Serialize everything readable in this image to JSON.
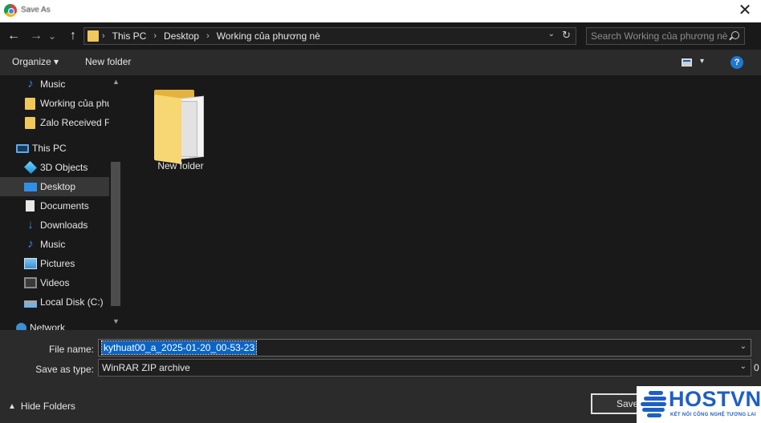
{
  "window": {
    "title": "Save As",
    "close_glyph": "✕"
  },
  "nav": {
    "back_glyph": "←",
    "forward_glyph": "→",
    "recent_glyph": "⌄",
    "up_glyph": "↑",
    "breadcrumbs": [
      "This PC",
      "Desktop",
      "Working của phương nè"
    ],
    "breadcrumb_sep": "›",
    "search_placeholder": "Search Working của phương nè"
  },
  "toolbar": {
    "organize_label": "Organize ▾",
    "new_folder_label": "New folder",
    "help_glyph": "?",
    "view_dd_glyph": "▾"
  },
  "sidebar": {
    "items": [
      {
        "label": "Music",
        "icon": "music-icon"
      },
      {
        "label": "Working của phư",
        "icon": "folder-icon"
      },
      {
        "label": "Zalo Received Fi",
        "icon": "folder-icon"
      },
      {
        "label": "This PC",
        "icon": "computer-icon"
      },
      {
        "label": "3D Objects",
        "icon": "cube-icon"
      },
      {
        "label": "Desktop",
        "icon": "desktop-icon",
        "selected": true
      },
      {
        "label": "Documents",
        "icon": "document-icon"
      },
      {
        "label": "Downloads",
        "icon": "download-icon"
      },
      {
        "label": "Music",
        "icon": "music-icon"
      },
      {
        "label": "Pictures",
        "icon": "pictures-icon"
      },
      {
        "label": "Videos",
        "icon": "videos-icon"
      },
      {
        "label": "Local Disk (C:)",
        "icon": "disk-icon"
      },
      {
        "label": "Network",
        "icon": "network-icon"
      }
    ]
  },
  "content": {
    "items": [
      {
        "label": "New folder",
        "icon": "folder-icon"
      }
    ]
  },
  "form": {
    "file_name_label": "File name:",
    "file_name_value": "kythuat00_a_2025-01-20_00-53-23",
    "save_type_label": "Save as type:",
    "save_type_value": "WinRAR ZIP archive",
    "cut_char": "0",
    "dropdown_glyph": "⌄"
  },
  "footer": {
    "hide_folders_label": "Hide Folders",
    "save_label": "Save"
  },
  "watermark": {
    "brand": "HOSTVN",
    "tagline": "KẾT NỐI CÔNG NGHỆ TƯƠNG LAI"
  },
  "colors": {
    "accent": "#0a64c6",
    "folder": "#f0c859",
    "brand": "#1e5fc4"
  }
}
